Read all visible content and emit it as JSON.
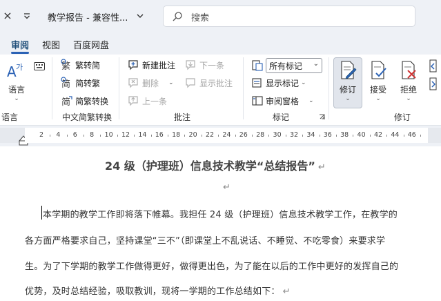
{
  "titlebar": {
    "close_glyph": "×",
    "document_title": "教学报告 - 兼容性...",
    "search_placeholder": "搜索"
  },
  "tabs": [
    {
      "label": "审阅",
      "active": true
    },
    {
      "label": "视图",
      "active": false
    },
    {
      "label": "百度网盘",
      "active": false
    }
  ],
  "ribbon": {
    "language": {
      "button_label": "语言",
      "group_label": "语言"
    },
    "chinese_conversion": {
      "traditional_to_simplified": "繁转简",
      "simplified_to_traditional": "简转繁",
      "conversion": "简繁转换",
      "group_label": "中文简繁转换"
    },
    "comments": {
      "new_comment": "新建批注",
      "next": "下一条",
      "delete": "删除",
      "show_comments": "显示批注",
      "previous": "上一条",
      "group_label": "批注"
    },
    "tracking": {
      "markup_select": "所有标记",
      "show_markup": "显示标记",
      "reviewing_pane": "审阅窗格",
      "group_label": "标记"
    },
    "changes": {
      "track_changes": "修订",
      "accept": "接受",
      "reject": "拒绝",
      "group_label": "修订"
    }
  },
  "ruler": {
    "ticks": [
      "2",
      "4",
      "6",
      "8",
      "10",
      "12",
      "14",
      "16",
      "18",
      "20",
      "22",
      "24",
      "26",
      "28",
      "30",
      "32",
      "34",
      "36",
      "38",
      "40",
      "42",
      "44",
      "46"
    ]
  },
  "document": {
    "title": "24 级（护理班）信息技术教学“总结报告”",
    "paragraph_mark": "↵",
    "lines": [
      "本学期的教学工作即将落下帷幕。我担任 24 级（护理班）信息技术教学工作，在教学的",
      "各方面严格要求自己，坚持课堂“三不”（即课堂上不乱说话、不睡觉、不吃零食）来要求学",
      "生。为了下学期的教学工作做得更好，做得更出色，为了能在以后的工作中更好的发挥自己的",
      "优势，及时总结经验，吸取教训，现将一学期的工作总结如下："
    ]
  },
  "colors": {
    "chrome_bg": "#eef1f6",
    "active_tab": "#1f4e79",
    "accent_blue": "#2b62b5",
    "reject_red": "#d03535"
  }
}
